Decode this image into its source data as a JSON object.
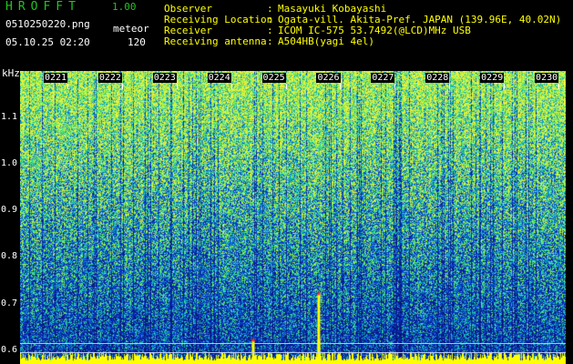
{
  "app": {
    "title": "HROFFT",
    "version": "1.00",
    "file_name": "0510250220.png",
    "mode_label": "meteor",
    "date_time": "05.10.25 02:20",
    "count": "120"
  },
  "meta": [
    {
      "label": "Observer",
      "value": "Masayuki Kobayashi"
    },
    {
      "label": "Receiving Location",
      "value": "Ogata-vill. Akita-Pref. JAPAN (139.96E, 40.02N)"
    },
    {
      "label": "Receiver",
      "value": "ICOM IC-575 53.7492(@LCD)MHz USB"
    },
    {
      "label": "Receiving antenna",
      "value": "A504HB(yagi 4el)"
    }
  ],
  "colors": {
    "title_green": "#21c421",
    "label_white": "#ffffff",
    "value_yellow": "#ffff00",
    "baseline_yellow": "#ffff00",
    "spectrum_deep": "#0a1aa0",
    "spectrum_hot": "#7fff40"
  },
  "chart_data": {
    "type": "heatmap",
    "ylabel": "kHz",
    "y_ticks": [
      {
        "value": 1.1,
        "label": "1.1"
      },
      {
        "value": 1.0,
        "label": "1.0"
      },
      {
        "value": 0.9,
        "label": "0.9"
      },
      {
        "value": 0.8,
        "label": "0.8"
      },
      {
        "value": 0.7,
        "label": "0.7"
      },
      {
        "value": 0.6,
        "label": "0.6"
      }
    ],
    "ylim": [
      0.57,
      1.2
    ],
    "x_ticks": [
      "0221",
      "0222",
      "0223",
      "0224",
      "0225",
      "0226",
      "0227",
      "0228",
      "0229",
      "0230"
    ],
    "reference_lines_khz": [
      0.615,
      0.595
    ],
    "meteor_echoes": [
      {
        "time_index": 3.8,
        "freq_khz": 0.62
      },
      {
        "time_index": 5.0,
        "freq_khz": 0.62
      },
      {
        "time_index": 5.0,
        "freq_khz": 0.72
      }
    ]
  }
}
